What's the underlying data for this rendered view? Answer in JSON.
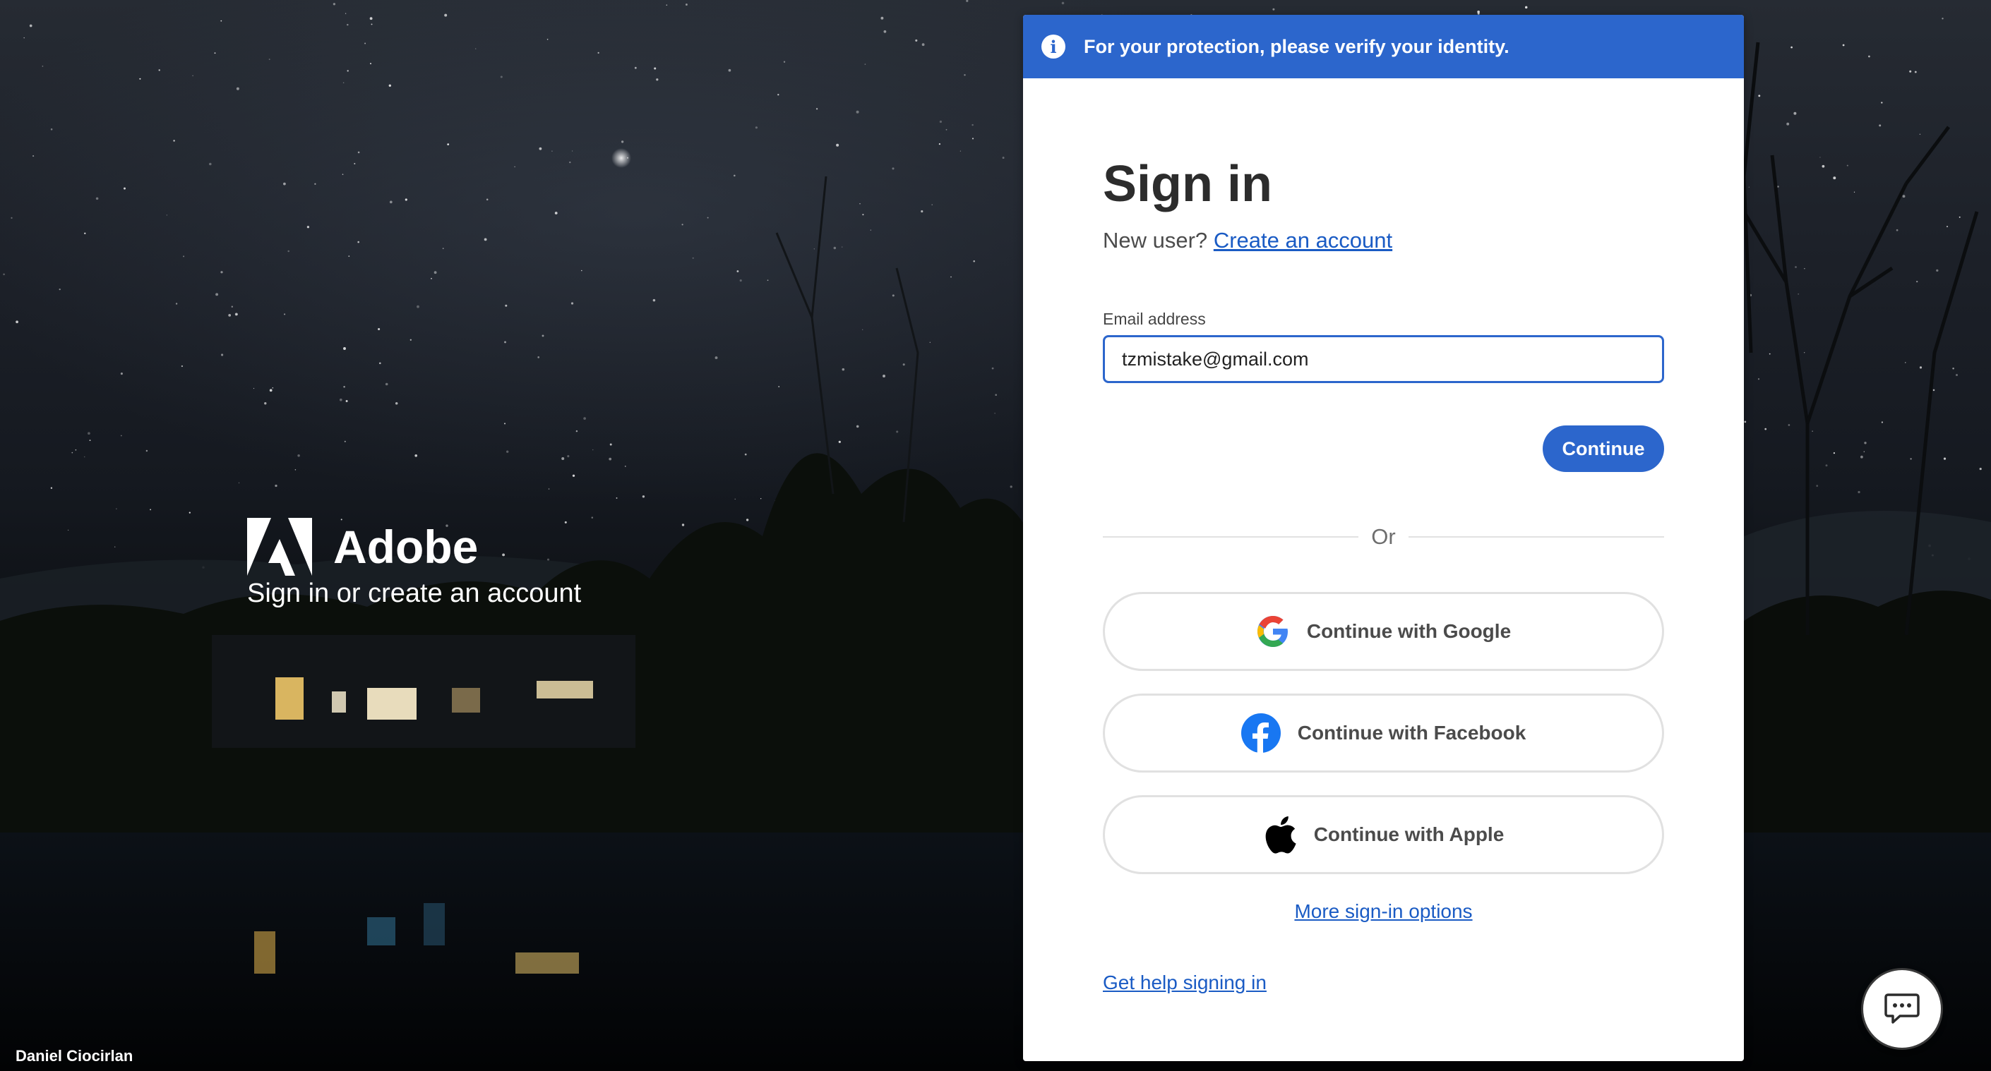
{
  "branding": {
    "logo_icon": "adobe-logo-icon",
    "name": "Adobe",
    "tagline": "Sign in or create an account",
    "photo_credit": "Daniel Ciocirlan"
  },
  "banner": {
    "icon": "info-icon",
    "text": "For your protection, please verify your identity.",
    "color": "#2c66cc"
  },
  "signin": {
    "title": "Sign in",
    "new_user_prefix": "New user?",
    "create_account_link": "Create an account",
    "email_label": "Email address",
    "email_value": "tzmistake@gmail.com",
    "continue_label": "Continue",
    "or_label": "Or"
  },
  "social": {
    "google_label": "Continue with Google",
    "facebook_label": "Continue with Facebook",
    "apple_label": "Continue with Apple"
  },
  "links": {
    "more_options": "More sign-in options",
    "help": "Get help signing in"
  },
  "chat": {
    "icon": "chat-bubble-icon"
  },
  "colors": {
    "accent": "#2c66cc",
    "link": "#1a5bc4",
    "facebook": "#1877f2"
  }
}
